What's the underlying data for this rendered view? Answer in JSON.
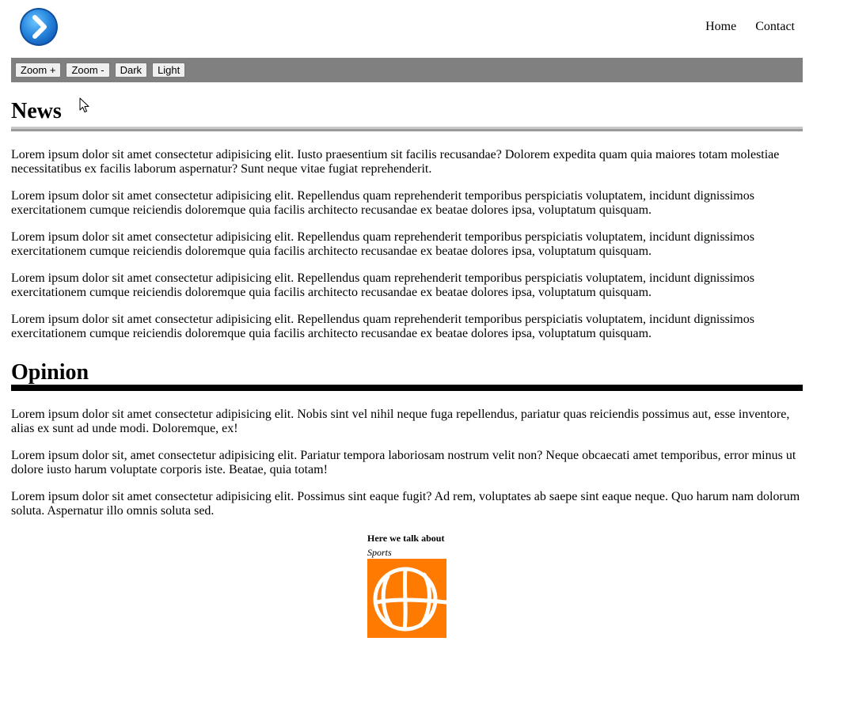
{
  "header": {
    "logo_icon": "chevron-right-circle-icon",
    "logo_colors": {
      "outer": "#1565c0",
      "inner": "#3a9be6",
      "arrow": "#ffffff"
    },
    "nav": [
      {
        "label": "Home"
      },
      {
        "label": "Contact"
      }
    ]
  },
  "toolbar": {
    "background": "#808080",
    "buttons": [
      {
        "label": "Zoom +"
      },
      {
        "label": "Zoom -"
      },
      {
        "label": "Dark"
      },
      {
        "label": "Light"
      }
    ]
  },
  "news": {
    "title": "News",
    "paragraphs": [
      "Lorem ipsum dolor sit amet consectetur adipisicing elit. Iusto praesentium sit facilis recusandae? Dolorem expedita quam quia maiores totam molestiae necessitatibus ex facilis laborum aspernatur? Sunt neque vitae fugiat reprehenderit.",
      "Lorem ipsum dolor sit amet consectetur adipisicing elit. Repellendus quam reprehenderit temporibus perspiciatis voluptatem, incidunt dignissimos exercitationem cumque reiciendis doloremque quia facilis architecto recusandae ex beatae dolores ipsa, voluptatum quisquam.",
      "Lorem ipsum dolor sit amet consectetur adipisicing elit. Repellendus quam reprehenderit temporibus perspiciatis voluptatem, incidunt dignissimos exercitationem cumque reiciendis doloremque quia facilis architecto recusandae ex beatae dolores ipsa, voluptatum quisquam.",
      "Lorem ipsum dolor sit amet consectetur adipisicing elit. Repellendus quam reprehenderit temporibus perspiciatis voluptatem, incidunt dignissimos exercitationem cumque reiciendis doloremque quia facilis architecto recusandae ex beatae dolores ipsa, voluptatum quisquam.",
      "Lorem ipsum dolor sit amet consectetur adipisicing elit. Repellendus quam reprehenderit temporibus perspiciatis voluptatem, incidunt dignissimos exercitationem cumque reiciendis doloremque quia facilis architecto recusandae ex beatae dolores ipsa, voluptatum quisquam."
    ]
  },
  "opinion": {
    "title": "Opinion",
    "paragraphs": [
      "Lorem ipsum dolor sit amet consectetur adipisicing elit. Nobis sint vel nihil neque fuga repellendus, pariatur quas reiciendis possimus aut, esse inventore, alias ex sunt ad unde modi. Doloremque, ex!",
      "Lorem ipsum dolor sit, amet consectetur adipisicing elit. Pariatur tempora laboriosam nostrum velit non? Neque obcaecati amet temporibus, error minus ut dolore iusto harum voluptate corporis iste. Beatae, quia totam!",
      "Lorem ipsum dolor sit amet consectetur adipisicing elit. Possimus sint eaque fugit? Ad rem, voluptates ab saepe sint eaque neque. Quo harum nam dolorum soluta. Aspernatur illo omnis soluta sed."
    ]
  },
  "aside": {
    "title": "Here we talk about",
    "subtitle": "Sports",
    "image_icon": "basketball-icon",
    "image_colors": {
      "background": "#ff7a00",
      "lines": "#ffffff"
    }
  },
  "cursor_icon": "mouse-pointer-icon"
}
